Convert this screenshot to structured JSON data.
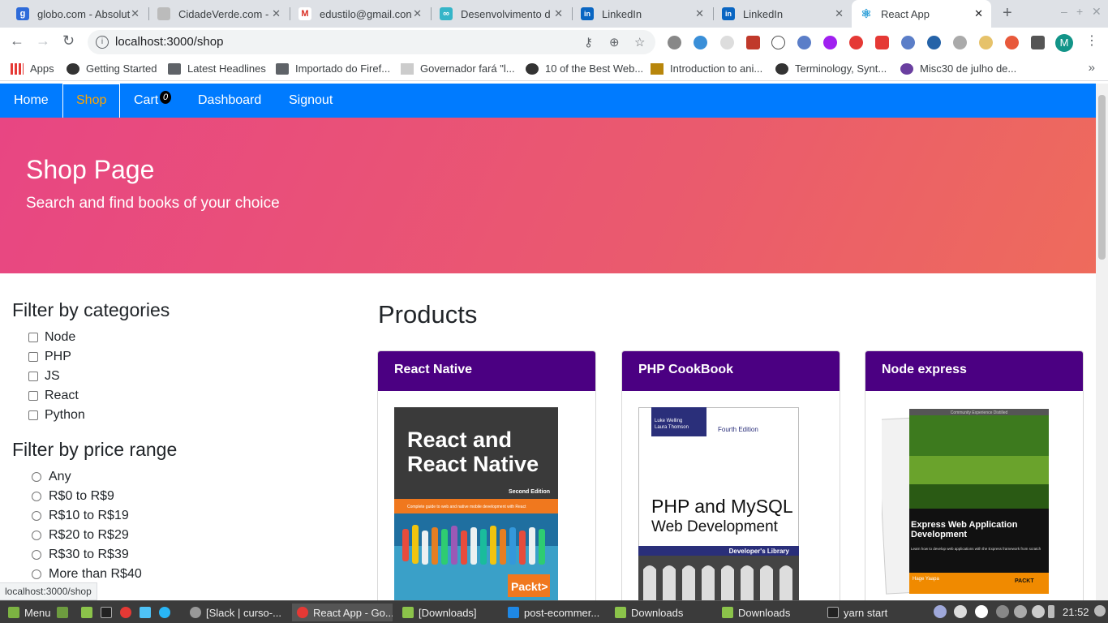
{
  "browser": {
    "tabs": [
      {
        "title": "globo.com - Absolut",
        "icon": "globo-icon",
        "color": "#2e6bd9",
        "glyph": "g",
        "active": false
      },
      {
        "title": "CidadeVerde.com - ",
        "icon": "cidadeverde-icon",
        "color": "#8a8a8a",
        "glyph": "",
        "active": false
      },
      {
        "title": "edustilo@gmail.con",
        "icon": "gmail-icon",
        "color": "#ffffff",
        "glyph": "M",
        "active": false
      },
      {
        "title": "Desenvolvimento d",
        "icon": "desenvolvimento-icon",
        "color": "#35b5c8",
        "glyph": "∞",
        "active": false
      },
      {
        "title": "LinkedIn",
        "icon": "linkedin-icon",
        "color": "#0a66c2",
        "glyph": "in",
        "active": false
      },
      {
        "title": "LinkedIn",
        "icon": "linkedin-icon",
        "color": "#0a66c2",
        "glyph": "in",
        "active": false
      },
      {
        "title": "React App",
        "icon": "react-icon",
        "color": "#61dafb",
        "glyph": "⚛",
        "active": true
      }
    ],
    "url": "localhost:3000/shop",
    "bookmarks": [
      {
        "label": "Apps",
        "icon": "apps-grid-icon"
      },
      {
        "label": "Getting Started",
        "icon": "getting-started-icon"
      },
      {
        "label": "Latest Headlines",
        "icon": "folder-icon"
      },
      {
        "label": "Importado do Firef...",
        "icon": "folder-icon"
      },
      {
        "label": "Governador fará \"l...",
        "icon": "news-icon"
      },
      {
        "label": "10 of the Best Web...",
        "icon": "web-icon"
      },
      {
        "label": "Introduction to ani...",
        "icon": "image-icon"
      },
      {
        "label": "Terminology, Synt...",
        "icon": "globe-icon"
      },
      {
        "label": "Misc30 de julho de...",
        "icon": "misc-icon"
      }
    ],
    "status_url": "localhost:3000/shop",
    "avatar_letter": "M"
  },
  "app": {
    "nav": {
      "home": "Home",
      "shop": "Shop",
      "cart": "Cart",
      "cart_count": "0",
      "dashboard": "Dashboard",
      "signout": "Signout"
    },
    "jumbotron": {
      "title": "Shop Page",
      "description": "Search and find books of your choice"
    },
    "filters": {
      "categories_title": "Filter by categories",
      "categories": [
        "Node",
        "PHP",
        "JS",
        "React",
        "Python"
      ],
      "price_title": "Filter by price range",
      "prices": [
        "Any",
        "R$0 to R$9",
        "R$10 to R$19",
        "R$20 to R$29",
        "R$30 to R$39",
        "More than R$40"
      ]
    },
    "products_title": "Products",
    "products": [
      {
        "name": "React Native",
        "cover": {
          "title_line1": "React and",
          "title_line2": "React Native",
          "edition": "Second Edition",
          "subtitle": "Complete guide to web and native mobile development with React",
          "publisher": "Packt>"
        }
      },
      {
        "name": "PHP CookBook",
        "cover": {
          "authors_line1": "Luke Welling",
          "authors_line2": "Laura Thomson",
          "edition": "Fourth Edition",
          "title_line1": "PHP and MySQL",
          "title_line2": "Web Development",
          "series": "Developer's Library"
        }
      },
      {
        "name": "Node express",
        "cover": {
          "banner": "Community Experience Distilled",
          "title_line1": "Express Web Application",
          "title_line2": "Development",
          "subtitle": "Learn how to develop web applications with the Express framework from scratch",
          "author": "Hage Yaapa",
          "publisher": "PACKT"
        }
      }
    ]
  },
  "taskbar": {
    "menu": "Menu",
    "items": [
      "[Slack | curso-...",
      "React App - Go...",
      "[Downloads]",
      "post-ecommer...",
      "Downloads",
      "Downloads",
      "yarn start"
    ],
    "clock": "21:52"
  },
  "colors": {
    "navbar": "#007bff",
    "nav_active": "#ffa500",
    "card_header": "#4b0082",
    "jumbo_start": "#e84683",
    "jumbo_end": "#ee6b5c"
  }
}
